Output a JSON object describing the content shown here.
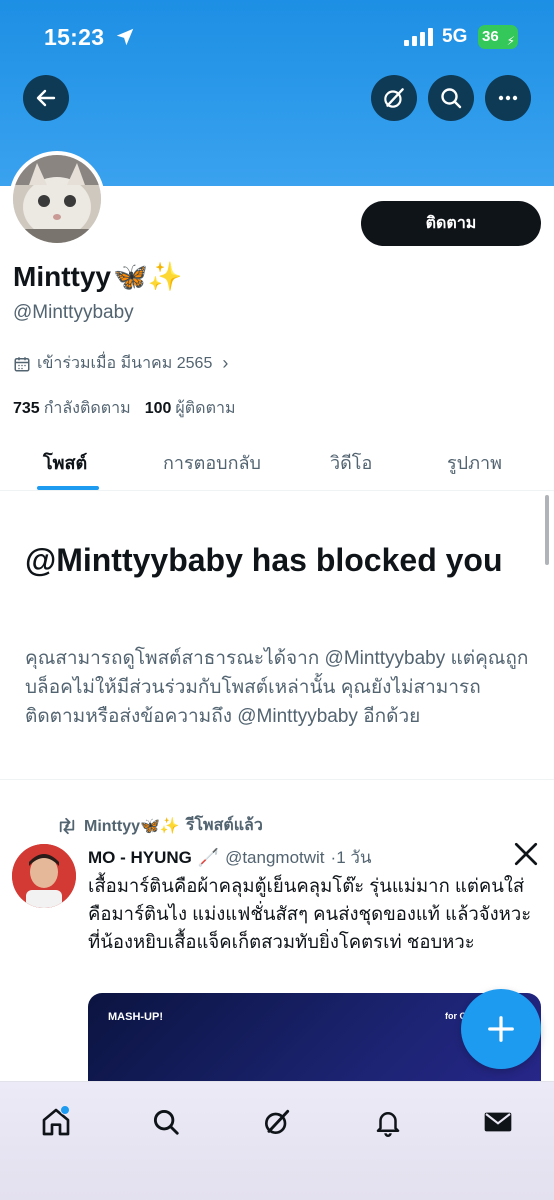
{
  "status_bar": {
    "time": "15:23",
    "network": "5G",
    "battery": "36"
  },
  "header": {
    "back_icon": "arrow-left-icon",
    "grok_icon": "grok-icon",
    "search_icon": "search-icon",
    "more_icon": "more-icon"
  },
  "profile": {
    "display_name": "Minttyy",
    "name_emojis": "🦋✨",
    "handle": "@Minttyybaby",
    "follow_label": "ติดตาม",
    "joined": "เข้าร่วมเมื่อ มีนาคม 2565",
    "following_count": "735",
    "following_label": "กำลังติดตาม",
    "followers_count": "100",
    "followers_label": "ผู้ติดตาม"
  },
  "tabs": [
    {
      "label": "โพสต์",
      "active": true
    },
    {
      "label": "การตอบกลับ",
      "active": false
    },
    {
      "label": "วิดีโอ",
      "active": false
    },
    {
      "label": "รูปภาพ",
      "active": false
    }
  ],
  "blocked": {
    "title": "@Minttyybaby has blocked you",
    "description": "คุณสามารถดูโพสต์สาธารณะได้จาก @Minttyybaby แต่คุณถูกบล็อคไม่ให้มีส่วนร่วมกับโพสต์เหล่านั้น คุณยังไม่สามารถติดตามหรือส่งข้อความถึง @Minttyybaby อีกด้วย"
  },
  "post": {
    "repost_by": "Minttyy🦋✨",
    "repost_label": "รีโพสต์แล้ว",
    "author_name": "MO - HYUNG",
    "author_handle": "@tangmotwit",
    "time": "·1 วัน",
    "text": "เสื้อมาร์ตินคือผ้าคลุมตู้เย็นคลุมโต๊ะ รุ่นแม่มาก แต่คนใส่คือมาร์ตินไง แม่งแฟชั่นสัสๆ คนส่งชุดของแท้ แล้วจังหวะที่น้องหยิบเสื้อแจ็คเก็ตสวมทับยิ่งโคตรเท่ ชอบหวะ",
    "media_label_left": "MASH-UP!",
    "media_label_right": "for C"
  },
  "bottom_nav": [
    "home-icon",
    "search-icon",
    "grok-icon",
    "bell-icon",
    "mail-icon"
  ],
  "colors": {
    "accent": "#1d9bf0",
    "banner": "#2a98ea",
    "text": "#0f1419",
    "muted": "#536471"
  }
}
